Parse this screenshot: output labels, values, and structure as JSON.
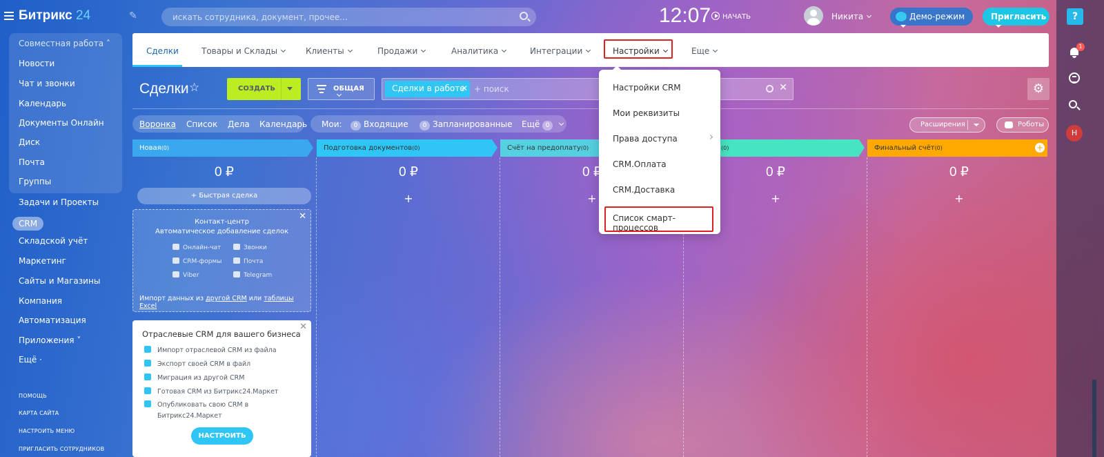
{
  "app": {
    "logo_text": "Битрикс",
    "logo_num": "24"
  },
  "header": {
    "search_placeholder": "искать сотрудника, документ, прочее...",
    "clock": "12:07",
    "start_label": "НАЧАТЬ",
    "user_name": "Никита",
    "demo_label": "Демо-режим",
    "invite_label": "Пригласить",
    "help": "?"
  },
  "right_panel": {
    "notification_count": "1",
    "user_initial": "Н"
  },
  "sidebar": {
    "group_label": "Совместная работа",
    "items": [
      "Новости",
      "Чат и звонки",
      "Календарь",
      "Документы Онлайн",
      "Диск",
      "Почта",
      "Группы",
      "Задачи и Проекты",
      "CRM",
      "Складской учёт",
      "Маркетинг",
      "Сайты и Магазины",
      "Компания",
      "Автоматизация",
      "Приложения",
      "Ещё"
    ],
    "footer": [
      "ПОМОЩЬ",
      "КАРТА САЙТА",
      "НАСТРОИТЬ МЕНЮ",
      "ПРИГЛАСИТЬ СОТРУДНИКОВ"
    ]
  },
  "tabs": [
    "Сделки",
    "Товары и Склады",
    "Клиенты",
    "Продажи",
    "Аналитика",
    "Интеграции",
    "Настройки",
    "Еще"
  ],
  "page": {
    "title": "Сделки",
    "create_label": "СОЗДАТЬ",
    "pipeline_label": "ОБЩАЯ",
    "filter_tag": "Сделки в работе",
    "filter_placeholder": "+ поиск",
    "views": [
      "Воронка",
      "Список",
      "Дела",
      "Календарь"
    ],
    "my_label": "Мои:",
    "incoming_count": "0",
    "incoming_label": "Входящие",
    "planned_count": "0",
    "planned_label": "Запланированные",
    "more_label": "Ещё",
    "more_count": "0",
    "extensions_label": "Расширения",
    "robots_label": "Роботы"
  },
  "stages": [
    {
      "name": "Новая",
      "count": "(0)",
      "sum": "0 ₽",
      "color": "#39a8ef"
    },
    {
      "name": "Подготовка документов",
      "count": "(0)",
      "sum": "0 ₽",
      "color": "#2fc6f6"
    },
    {
      "name": "Счёт на предоплату",
      "count": "(0)",
      "sum": "0 ₽",
      "color": "#55d0e0"
    },
    {
      "name": "",
      "count": "(0)",
      "sum": "0 ₽",
      "color": "#47e4c2"
    },
    {
      "name": "Финальный счёт",
      "count": "(0)",
      "sum": "0 ₽",
      "color": "#ffa900"
    }
  ],
  "quick_deal": "+ Быстрая сделка",
  "contact_center": {
    "title": "Контакт-центр",
    "subtitle": "Автоматическое добавление сделок",
    "channels": [
      "Онлайн-чат",
      "Звонки",
      "CRM-формы",
      "Почта",
      "Viber",
      "Telegram"
    ],
    "import_prefix": "Импорт данных из",
    "import_link1": "другой CRM",
    "import_mid": "или",
    "import_link2": "таблицы Excel"
  },
  "industry": {
    "title": "Отраслевые CRM для вашего бизнеса",
    "items": [
      "Импорт отраслевой CRM из файла",
      "Экспорт своей CRM в файл",
      "Миграция из другой CRM",
      "Готовая CRM из Битрикс24.Маркет",
      "Опубликовать свою CRM в",
      "Битрикс24.Маркет"
    ],
    "button": "НАСТРОИТЬ"
  },
  "dropdown": {
    "items": [
      "Настройки CRM",
      "Мои реквизиты",
      "Права доступа",
      "CRM.Оплата",
      "CRM.Доставка",
      "Список смарт-процессов"
    ]
  }
}
